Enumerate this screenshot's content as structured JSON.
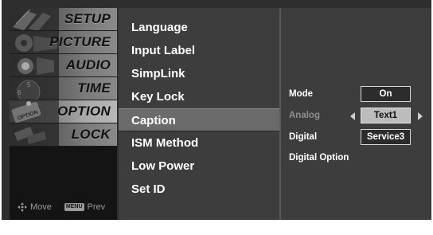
{
  "categories": [
    {
      "label": "SETUP",
      "icon": "film-strip-icon",
      "selected": false
    },
    {
      "label": "PICTURE",
      "icon": "film-reel-icon",
      "selected": false
    },
    {
      "label": "AUDIO",
      "icon": "speaker-icon",
      "selected": false
    },
    {
      "label": "TIME",
      "icon": "clock-icon",
      "selected": false
    },
    {
      "label": "OPTION",
      "icon": "option-badge-icon",
      "selected": true
    },
    {
      "label": "LOCK",
      "icon": "lock-icon",
      "selected": false
    }
  ],
  "footer": {
    "move_label": "Move",
    "menu_key": "MENU",
    "prev_label": "Prev"
  },
  "submenu": [
    {
      "label": "Language",
      "selected": false
    },
    {
      "label": "Input Label",
      "selected": false
    },
    {
      "label": "SimpLink",
      "selected": false
    },
    {
      "label": "Key Lock",
      "selected": false
    },
    {
      "label": "Caption",
      "selected": true
    },
    {
      "label": "ISM Method",
      "selected": false
    },
    {
      "label": "Low Power",
      "selected": false
    },
    {
      "label": "Set ID",
      "selected": false
    }
  ],
  "options": {
    "mode": {
      "label": "Mode",
      "value": "On"
    },
    "analog": {
      "label": "Analog",
      "value": "Text1"
    },
    "digital": {
      "label": "Digital",
      "value": "Service3"
    },
    "digital_option": {
      "label": "Digital Option"
    }
  },
  "colors": {
    "background": "#2e2e2e",
    "panel": "#3d3d3d",
    "highlight": "#6b6b6b",
    "active_box": "#bcbcbc",
    "text": "#ffffff",
    "dim_text": "#8e8e8e"
  }
}
